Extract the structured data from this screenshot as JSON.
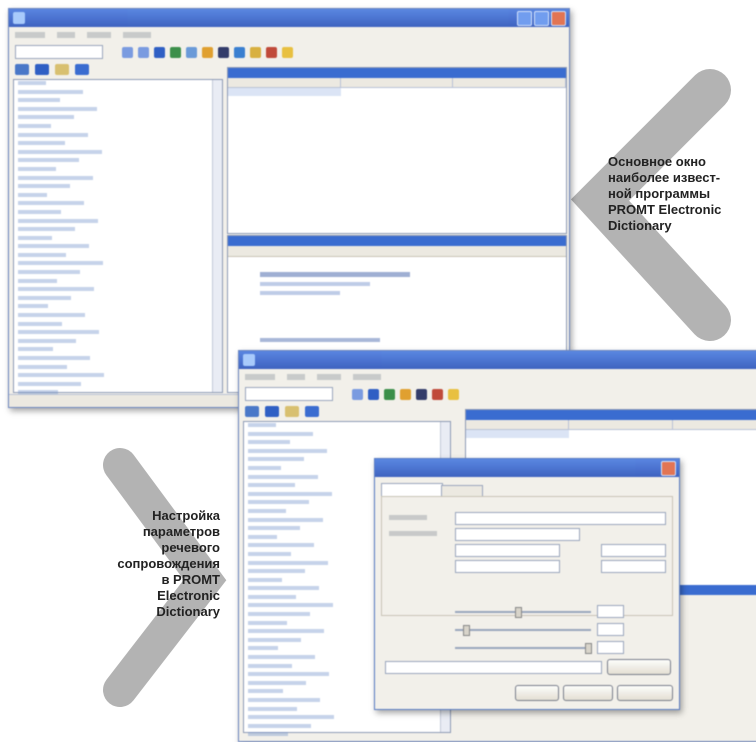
{
  "captions": {
    "right": [
      "Основное окно",
      "наиболее извест-",
      "ной программы",
      "PROMT Electronic",
      "Dictionary"
    ],
    "left": [
      "Настройка",
      "параметров",
      "речевого",
      "сопровождения",
      "в PROMT",
      "Electronic",
      "Dictionary"
    ]
  },
  "colors": {
    "chevron": "#b3b3b3",
    "titlebar": "#2a5ad0",
    "caption_text": "#222222"
  },
  "main_window": {
    "list_items_count_visible": 38
  },
  "icons": [
    "app-icon",
    "minimize-icon",
    "maximize-icon",
    "close-icon",
    "home-icon",
    "book-icon",
    "toolbar-icon"
  ]
}
